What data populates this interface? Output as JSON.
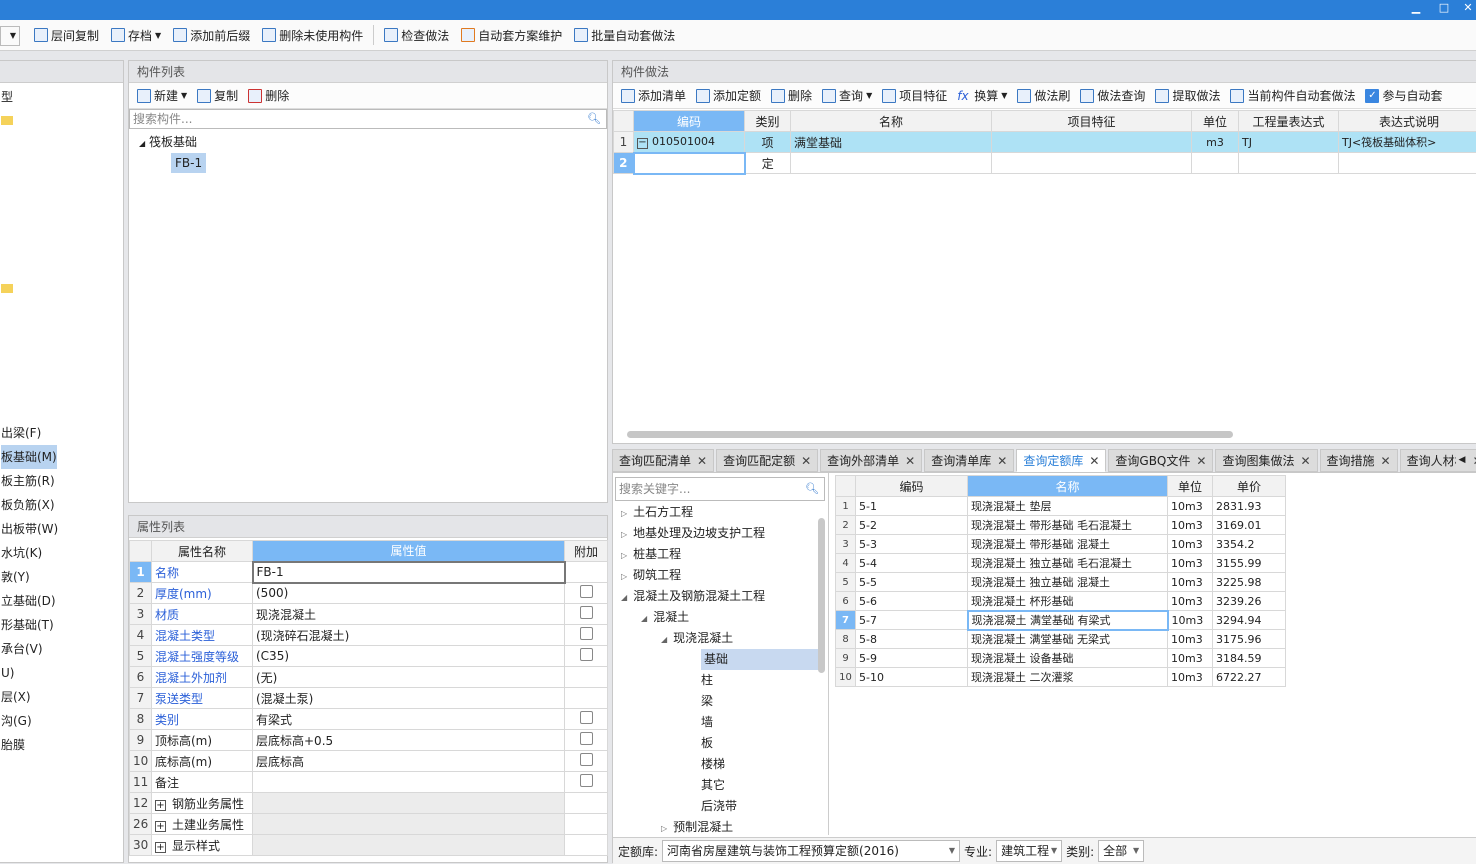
{
  "window": {
    "minimize": "▁",
    "maximize": "□",
    "close": "✕"
  },
  "toolbar": [
    "层间复制",
    "存档",
    "添加前后缀",
    "删除未使用构件",
    "检查做法",
    "自动套方案维护",
    "批量自动套做法"
  ],
  "left_panel": {
    "top_item": "型",
    "items": [
      "出梁(F)",
      "板基础(M)",
      "板主筋(R)",
      "板负筋(X)",
      "出板带(W)",
      "水坑(K)",
      "敦(Y)",
      "立基础(D)",
      "形基础(T)",
      "承台(V)",
      "U)",
      "层(X)",
      "沟(G)",
      "胎膜"
    ],
    "selected": "板基础(M)"
  },
  "component_list": {
    "title": "构件列表",
    "buttons": [
      "新建",
      "复制",
      "删除"
    ],
    "search_placeholder": "搜索构件...",
    "tree_root": "筏板基础",
    "tree_child": "FB-1"
  },
  "properties": {
    "title": "属性列表",
    "headers": [
      "属性名称",
      "属性值",
      "附加"
    ],
    "rows": [
      {
        "n": "1",
        "name": "名称",
        "value": "FB-1",
        "blue": true,
        "chk": false
      },
      {
        "n": "2",
        "name": "厚度(mm)",
        "value": "(500)",
        "blue": true,
        "chk": true
      },
      {
        "n": "3",
        "name": "材质",
        "value": "现浇混凝土",
        "blue": true,
        "chk": true
      },
      {
        "n": "4",
        "name": "混凝土类型",
        "value": "(现浇碎石混凝土)",
        "blue": true,
        "chk": true
      },
      {
        "n": "5",
        "name": "混凝土强度等级",
        "value": "(C35)",
        "blue": true,
        "chk": true
      },
      {
        "n": "6",
        "name": "混凝土外加剂",
        "value": "(无)",
        "blue": true,
        "chk": false
      },
      {
        "n": "7",
        "name": "泵送类型",
        "value": "(混凝土泵)",
        "blue": true,
        "chk": false
      },
      {
        "n": "8",
        "name": "类别",
        "value": "有梁式",
        "blue": true,
        "chk": true
      },
      {
        "n": "9",
        "name": "顶标高(m)",
        "value": "层底标高+0.5",
        "blue": false,
        "chk": true
      },
      {
        "n": "10",
        "name": "底标高(m)",
        "value": "层底标高",
        "blue": false,
        "chk": true
      },
      {
        "n": "11",
        "name": "备注",
        "value": "",
        "blue": false,
        "chk": true
      },
      {
        "n": "12",
        "name": "钢筋业务属性",
        "value": "",
        "group": true
      },
      {
        "n": "26",
        "name": "土建业务属性",
        "value": "",
        "group": true
      },
      {
        "n": "30",
        "name": "显示样式",
        "value": "",
        "group": true
      }
    ]
  },
  "method": {
    "title": "构件做法",
    "buttons": [
      "添加清单",
      "添加定额",
      "删除",
      "查询",
      "项目特征",
      "换算",
      "做法刷",
      "做法查询",
      "提取做法",
      "当前构件自动套做法",
      "参与自动套"
    ],
    "headers": [
      "编码",
      "类别",
      "名称",
      "项目特征",
      "单位",
      "工程量表达式",
      "表达式说明"
    ],
    "rows": [
      {
        "n": "1",
        "code": "010501004",
        "type": "项",
        "name": "满堂基础",
        "feature": "",
        "unit": "m3",
        "expr": "TJ",
        "desc": "TJ<筏板基础体积>"
      },
      {
        "n": "2",
        "code": "",
        "type": "定",
        "name": "",
        "feature": "",
        "unit": "",
        "expr": "",
        "desc": ""
      }
    ]
  },
  "query": {
    "tabs": [
      "查询匹配清单",
      "查询匹配定额",
      "查询外部清单",
      "查询清单库",
      "查询定额库",
      "查询GBQ文件",
      "查询图集做法",
      "查询措施",
      "查询人材机"
    ],
    "active_tab": "查询定额库",
    "search_placeholder": "搜索关键字...",
    "tree": [
      {
        "label": "土石方工程",
        "lvl": 0,
        "state": "closed"
      },
      {
        "label": "地基处理及边坡支护工程",
        "lvl": 0,
        "state": "closed"
      },
      {
        "label": "桩基工程",
        "lvl": 0,
        "state": "closed"
      },
      {
        "label": "砌筑工程",
        "lvl": 0,
        "state": "closed"
      },
      {
        "label": "混凝土及钢筋混凝土工程",
        "lvl": 0,
        "state": "open"
      },
      {
        "label": "混凝土",
        "lvl": 1,
        "state": "open"
      },
      {
        "label": "现浇混凝土",
        "lvl": 2,
        "state": "open"
      },
      {
        "label": "基础",
        "lvl": 3,
        "state": "leaf",
        "selected": true
      },
      {
        "label": "柱",
        "lvl": 3,
        "state": "leaf"
      },
      {
        "label": "梁",
        "lvl": 3,
        "state": "leaf"
      },
      {
        "label": "墙",
        "lvl": 3,
        "state": "leaf"
      },
      {
        "label": "板",
        "lvl": 3,
        "state": "leaf"
      },
      {
        "label": "楼梯",
        "lvl": 3,
        "state": "leaf"
      },
      {
        "label": "其它",
        "lvl": 3,
        "state": "leaf"
      },
      {
        "label": "后浇带",
        "lvl": 3,
        "state": "leaf"
      },
      {
        "label": "预制混凝土",
        "lvl": 2,
        "state": "closed"
      }
    ],
    "headers": [
      "编码",
      "名称",
      "单位",
      "单价"
    ],
    "rows": [
      [
        "5-1",
        "现浇混凝土 垫层",
        "10m3",
        "2831.93"
      ],
      [
        "5-2",
        "现浇混凝土 带形基础 毛石混凝土",
        "10m3",
        "3169.01"
      ],
      [
        "5-3",
        "现浇混凝土 带形基础 混凝土",
        "10m3",
        "3354.2"
      ],
      [
        "5-4",
        "现浇混凝土 独立基础 毛石混凝土",
        "10m3",
        "3155.99"
      ],
      [
        "5-5",
        "现浇混凝土 独立基础 混凝土",
        "10m3",
        "3225.98"
      ],
      [
        "5-6",
        "现浇混凝土 杯形基础",
        "10m3",
        "3239.26"
      ],
      [
        "5-7",
        "现浇混凝土 满堂基础 有梁式",
        "10m3",
        "3294.94"
      ],
      [
        "5-8",
        "现浇混凝土 满堂基础 无梁式",
        "10m3",
        "3175.96"
      ],
      [
        "5-9",
        "现浇混凝土 设备基础",
        "10m3",
        "3184.59"
      ],
      [
        "5-10",
        "现浇混凝土 二次灌浆",
        "10m3",
        "6722.27"
      ]
    ],
    "selected_row": 7,
    "footer": {
      "lib_label": "定额库:",
      "lib_value": "河南省房屋建筑与装饰工程预算定额(2016)",
      "major_label": "专业:",
      "major_value": "建筑工程",
      "type_label": "类别:",
      "type_value": "全部"
    }
  },
  "colors": {
    "accent": "#7ab8f5",
    "titlebar": "#2b7fd8",
    "link": "#2a5fd8"
  }
}
